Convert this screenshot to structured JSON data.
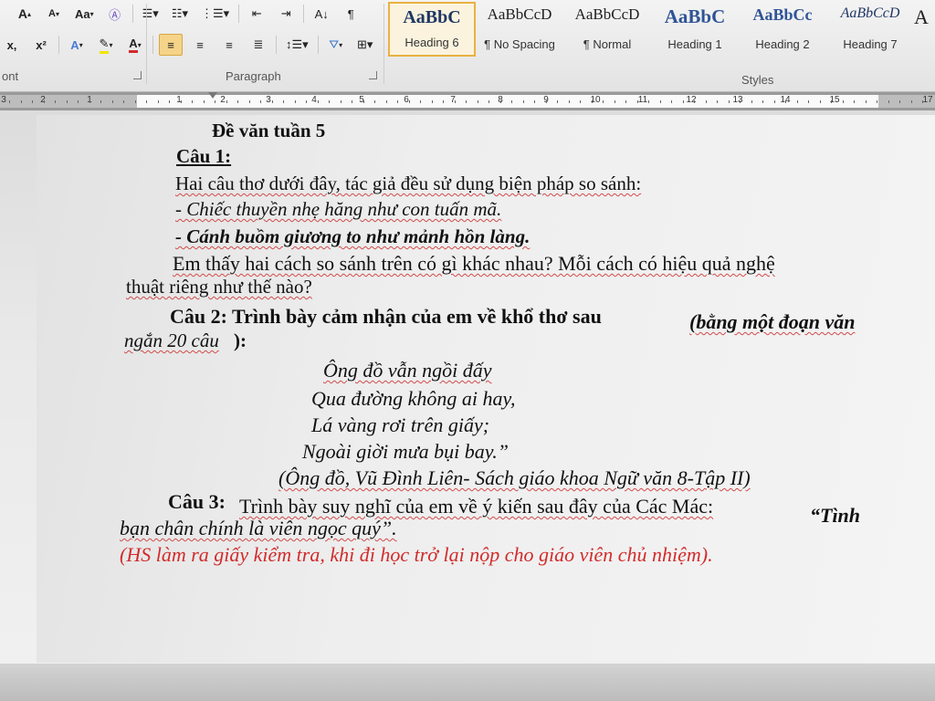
{
  "ribbon": {
    "font_group_label": "ont",
    "paragraph_group_label": "Paragraph",
    "styles_group_label": "Styles",
    "font_size_up": "A",
    "font_size_down": "A",
    "change_case": "Aa",
    "clear_format": "A",
    "subscript": "x,",
    "superscript": "x²",
    "font_color": "A",
    "styles": [
      {
        "preview": "AaBbC",
        "name": "Heading 6",
        "selected": true
      },
      {
        "preview": "AaBbCcD",
        "name": "¶ No Spacing",
        "selected": false
      },
      {
        "preview": "AaBbCcD",
        "name": "¶ Normal",
        "selected": false
      },
      {
        "preview": "AaBbC",
        "name": "Heading 1",
        "selected": false
      },
      {
        "preview": "AaBbCc",
        "name": "Heading 2",
        "selected": false
      },
      {
        "preview": "AaBbCcD",
        "name": "Heading 7",
        "selected": false
      }
    ],
    "more_styles": "A"
  },
  "ruler": {
    "numbers": [
      "3",
      "2",
      "1",
      "1",
      "2",
      "3",
      "4",
      "5",
      "6",
      "7",
      "8",
      "9",
      "10",
      "11",
      "12",
      "13",
      "14",
      "15",
      "17"
    ]
  },
  "document": {
    "title": "Đề văn tuần 5",
    "q1_label": "Câu 1:",
    "q1_line1": "Hai câu thơ dưới đây, tác giả đều sử dụng biện pháp so sánh:",
    "q1_quote1": "- Chiếc thuyền nhẹ hăng như con tuấn mã.",
    "q1_quote2": "- Cánh buồm giương to như mảnh hồn làng.",
    "q1_line2": "Em thấy hai cách so sánh trên có gì khác nhau? Mỗi cách có hiệu quả nghệ",
    "q1_line3": "thuật riêng như thế nào?",
    "q2_label": "Câu 2: Trình bày cảm nhận của em về khổ thơ sau",
    "q2_paren1": "(bằng một đoạn văn",
    "q2_paren2": "ngắn 20 câu",
    "q2_paren2_end": "):",
    "poem": [
      "Ông đồ vẫn ngồi đấy",
      "Qua đường không ai hay,",
      "Lá vàng rơi trên giấy;",
      "Ngoài giời mưa bụi bay.”"
    ],
    "source": "(Ông đồ, Vũ Đình Liên- Sách giáo khoa Ngữ văn 8-Tập II)",
    "q3_label": "Câu 3:",
    "q3_text": "Trình bày suy nghĩ của em về ý kiến sau đây của Các Mác:",
    "q3_quote_start": "“Tình",
    "q3_quote_end": "bạn chân chính là viên ngọc quý”.",
    "note": "(HS làm ra giấy kiểm tra, khi đi học trở lại nộp cho giáo viên chủ nhiệm)."
  }
}
